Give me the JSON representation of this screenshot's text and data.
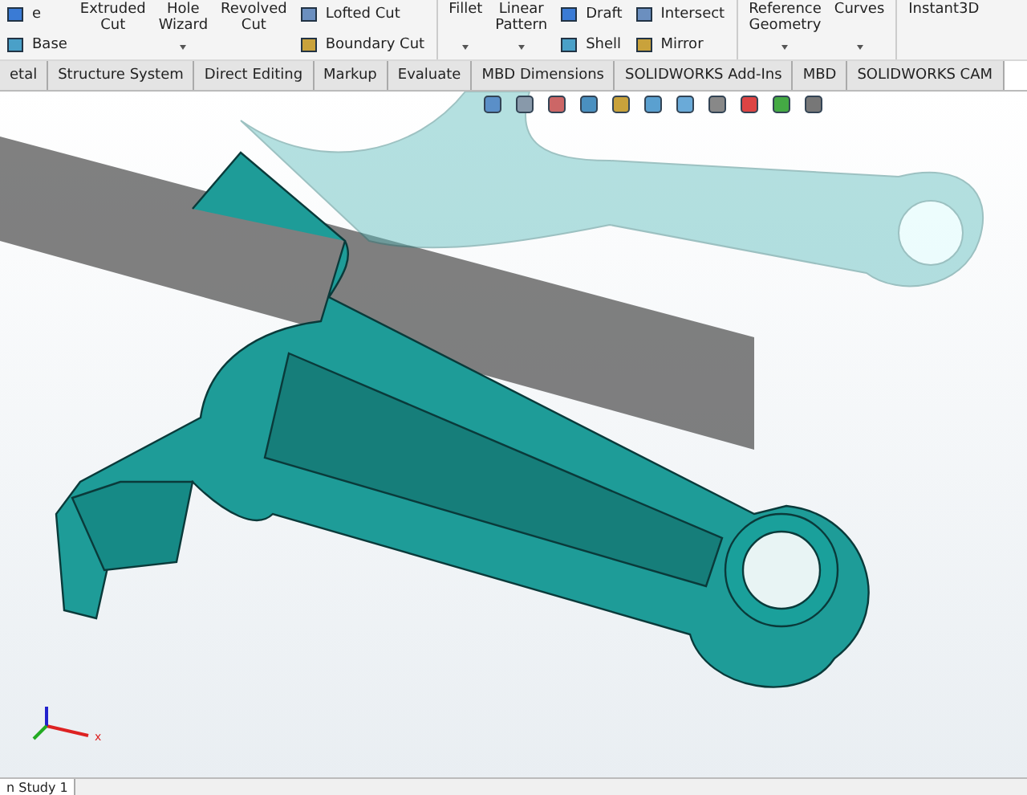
{
  "ribbon": {
    "groups": [
      {
        "kind": "small",
        "items": [
          {
            "label": "e"
          },
          {
            "label": "Base"
          }
        ]
      },
      {
        "kind": "large",
        "label": "Extruded\nCut",
        "dropdown": false
      },
      {
        "kind": "large",
        "label": "Hole\nWizard",
        "dropdown": true
      },
      {
        "kind": "large",
        "label": "Revolved\nCut",
        "dropdown": false
      },
      {
        "kind": "small",
        "items": [
          {
            "label": "Lofted Cut"
          },
          {
            "label": "Boundary Cut"
          }
        ]
      },
      {
        "kind": "separator"
      },
      {
        "kind": "large",
        "label": "Fillet",
        "dropdown": true
      },
      {
        "kind": "large",
        "label": "Linear\nPattern",
        "dropdown": true
      },
      {
        "kind": "small",
        "items": [
          {
            "label": "Draft"
          },
          {
            "label": "Shell"
          }
        ]
      },
      {
        "kind": "small",
        "items": [
          {
            "label": "Intersect"
          },
          {
            "label": "Mirror"
          }
        ]
      },
      {
        "kind": "separator"
      },
      {
        "kind": "large",
        "label": "Reference\nGeometry",
        "dropdown": true
      },
      {
        "kind": "large",
        "label": "Curves",
        "dropdown": true
      },
      {
        "kind": "separator"
      },
      {
        "kind": "large",
        "label": "Instant3D",
        "dropdown": false
      }
    ]
  },
  "tabs": [
    {
      "label": "etal",
      "selected": false
    },
    {
      "label": "Structure System",
      "selected": false
    },
    {
      "label": "Direct Editing",
      "selected": false
    },
    {
      "label": "Markup",
      "selected": false
    },
    {
      "label": "Evaluate",
      "selected": false
    },
    {
      "label": "MBD Dimensions",
      "selected": false
    },
    {
      "label": "SOLIDWORKS Add-Ins",
      "selected": false
    },
    {
      "label": "MBD",
      "selected": false
    },
    {
      "label": "SOLIDWORKS CAM",
      "selected": false
    }
  ],
  "triad": {
    "x_label": "x"
  },
  "bottom_tabs": [
    {
      "label": "n Study 1",
      "selected": false
    }
  ]
}
